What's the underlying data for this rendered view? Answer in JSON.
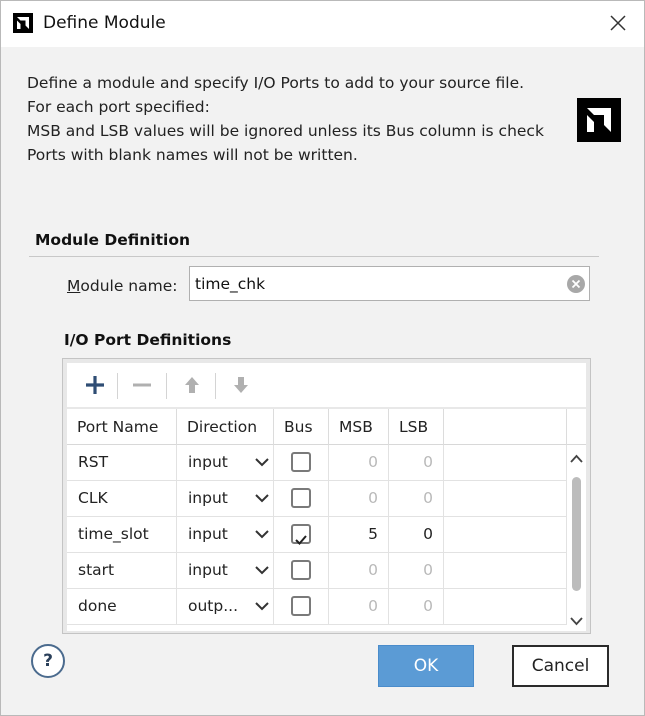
{
  "window": {
    "title": "Define Module"
  },
  "description": {
    "line1": "Define a module and specify I/O Ports to add to your source file.",
    "line2": "For each port specified:",
    "line3": "MSB and LSB values will be ignored unless its Bus column is check",
    "line4": "Ports with blank names will not be written."
  },
  "module_definition": {
    "section_title": "Module Definition",
    "name_label_accel": "M",
    "name_label_rest": "odule name:",
    "name_value": "time_chk"
  },
  "ports": {
    "section_title": "I/O Port Definitions",
    "toolbar": {
      "add": "+",
      "remove": "−",
      "move_up": "move-up",
      "move_down": "move-down"
    },
    "columns": [
      "Port Name",
      "Direction",
      "Bus",
      "MSB",
      "LSB"
    ],
    "rows": [
      {
        "name": "RST",
        "direction": "input",
        "bus": false,
        "msb": "0",
        "lsb": "0"
      },
      {
        "name": "CLK",
        "direction": "input",
        "bus": false,
        "msb": "0",
        "lsb": "0"
      },
      {
        "name": "time_slot",
        "direction": "input",
        "bus": true,
        "msb": "5",
        "lsb": "0"
      },
      {
        "name": "start",
        "direction": "input",
        "bus": false,
        "msb": "0",
        "lsb": "0"
      },
      {
        "name": "done",
        "direction": "outp...",
        "bus": false,
        "msb": "0",
        "lsb": "0"
      }
    ]
  },
  "buttons": {
    "help": "?",
    "ok": "OK",
    "cancel": "Cancel"
  },
  "colors": {
    "ok_blue": "#5b9bd5",
    "toolbar_icon": "#2f4d74",
    "disabled_text": "#b9b9b9"
  }
}
